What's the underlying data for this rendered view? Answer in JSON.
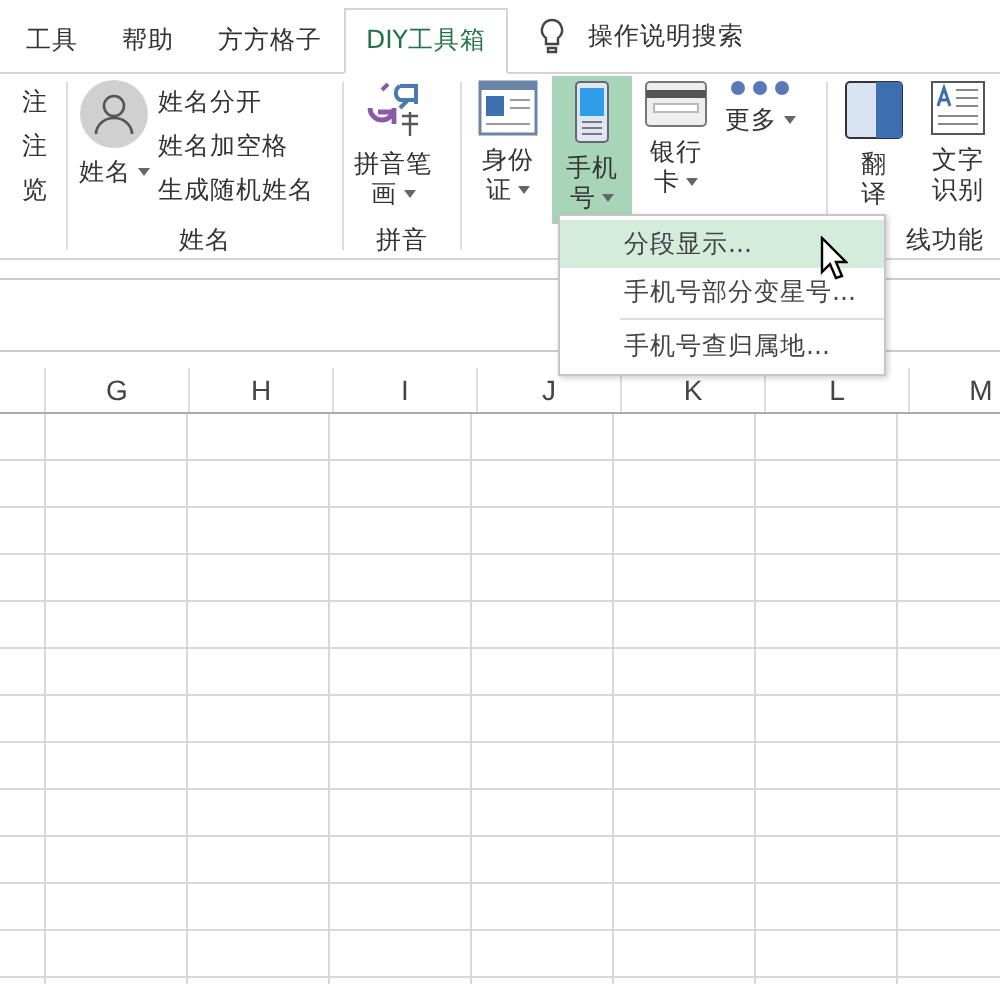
{
  "tabs": [
    {
      "label": "工具",
      "selected": false
    },
    {
      "label": "帮助",
      "selected": false
    },
    {
      "label": "方方格子",
      "selected": false
    },
    {
      "label": "DIY工具箱",
      "selected": true
    }
  ],
  "search": {
    "label": "操作说明搜索"
  },
  "ribbon": {
    "groups": [
      {
        "items": [
          {
            "kind": "small",
            "label": "注"
          },
          {
            "kind": "small",
            "label": "注"
          },
          {
            "kind": "small",
            "label": "览"
          }
        ]
      },
      {
        "label": "姓名",
        "items": [
          {
            "kind": "large",
            "lines": [
              "姓名"
            ],
            "dropdown": true,
            "selected": false
          },
          {
            "kind": "small",
            "label": "姓名分开"
          },
          {
            "kind": "small",
            "label": "姓名加空格"
          },
          {
            "kind": "small",
            "label": "生成随机姓名"
          }
        ]
      },
      {
        "label": "拼音",
        "items": [
          {
            "kind": "large",
            "lines": [
              "拼音笔",
              "画"
            ],
            "dropdown": true,
            "selected": false
          }
        ]
      },
      {
        "items": [
          {
            "kind": "large",
            "lines": [
              "身份",
              "证"
            ],
            "dropdown": true,
            "selected": false
          },
          {
            "kind": "large",
            "lines": [
              "手机",
              "号"
            ],
            "dropdown": true,
            "selected": true
          },
          {
            "kind": "large",
            "lines": [
              "银行",
              "卡"
            ],
            "dropdown": true,
            "selected": false
          },
          {
            "kind": "large",
            "lines": [
              "更多"
            ],
            "dropdown": true,
            "selected": false
          }
        ]
      },
      {
        "label": "线功能",
        "items": [
          {
            "kind": "large",
            "lines": [
              "翻",
              "译"
            ],
            "dropdown": false,
            "selected": false
          },
          {
            "kind": "large",
            "lines": [
              "文字",
              "识别"
            ],
            "dropdown": false,
            "selected": false
          }
        ]
      }
    ]
  },
  "columns": [
    "G",
    "H",
    "I",
    "J",
    "K",
    "L",
    "M"
  ],
  "menu": {
    "items": [
      {
        "kind": "item",
        "label": "分段显示...",
        "selected": true
      },
      {
        "kind": "item",
        "label": "手机号部分变星号...",
        "selected": false
      },
      {
        "kind": "separator"
      },
      {
        "kind": "item",
        "label": "手机号查归属地...",
        "selected": false
      }
    ]
  }
}
